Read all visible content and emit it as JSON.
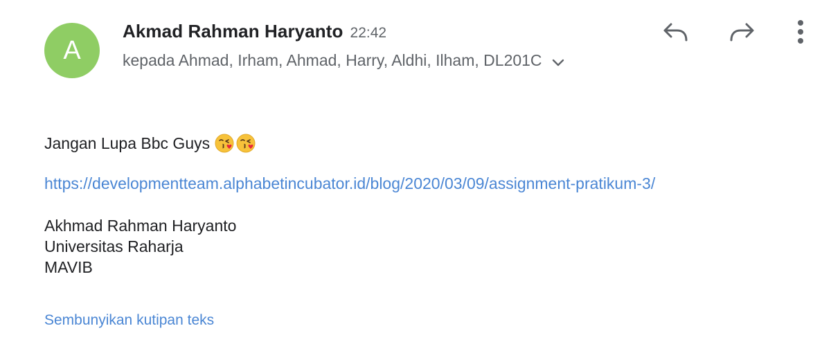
{
  "message": {
    "avatar_initial": "A",
    "sender_name": "Akmad Rahman Haryanto",
    "time": "22:42",
    "recipients": "kepada Ahmad, Irham, Ahmad, Harry, Aldhi, Ilham, DL201C"
  },
  "actions": {
    "reply_icon": "reply-icon",
    "forward_icon": "forward-icon",
    "more_icon": "more-vertical-icon",
    "expand_icon": "chevron-down-icon"
  },
  "body": {
    "greeting": "Jangan Lupa Bbc Guys",
    "emoji_icon": "face-blowing-kiss-emoji",
    "link": "https://developmentteam.alphabetincubator.id/blog/2020/03/09/assignment-pratikum-3/",
    "signature": {
      "name": "Akhmad Rahman Haryanto",
      "organization": "Universitas Raharja",
      "department": "MAVIB"
    },
    "quote_toggle": "Sembunyikan kutipan teks"
  },
  "colors": {
    "avatar_bg": "#8fcd64",
    "link": "#4a86d4",
    "icon": "#5f6368"
  }
}
